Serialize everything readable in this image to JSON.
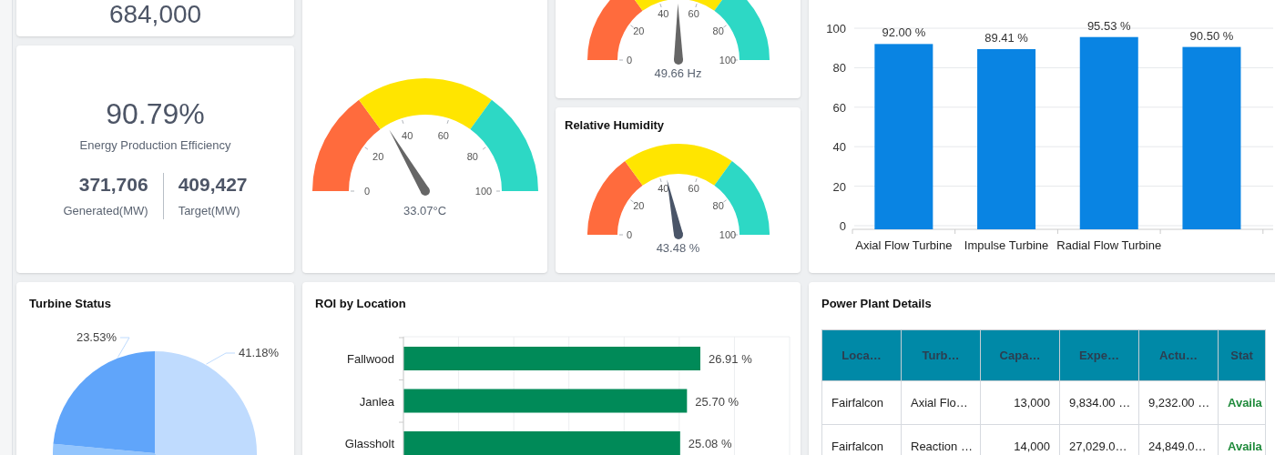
{
  "summary_card": {
    "value": "684,000"
  },
  "efficiency_card": {
    "value": "90.79%",
    "label": "Energy Production Efficiency",
    "generated": {
      "value": "371,706",
      "label": "Generated(MW)"
    },
    "target": {
      "value": "409,427",
      "label": "Target(MW)"
    }
  },
  "temperature_gauge": {
    "level": 0.3307,
    "reading": "33.07°C",
    "ticks": [
      "0",
      "20",
      "40",
      "60",
      "80",
      "100"
    ]
  },
  "frequency_gauge": {
    "level": 0.4966,
    "reading": "49.66 Hz",
    "ticks": [
      "0",
      "20",
      "40",
      "60",
      "80",
      "100"
    ]
  },
  "humidity_gauge": {
    "title": "Relative Humidity",
    "level": 0.4348,
    "reading": "43.48 %",
    "ticks": [
      "0",
      "20",
      "40",
      "60",
      "80",
      "100"
    ]
  },
  "turbine_efficiency_chart": {
    "chart_data": {
      "type": "bar",
      "categories": [
        "Axial Flow Turbine",
        "Impulse Turbine",
        "Radial Flow Turbine",
        null
      ],
      "values": [
        92.0,
        89.41,
        95.53,
        90.5
      ],
      "ylim": [
        0,
        100
      ],
      "grid": true,
      "yticks": [
        0,
        20,
        40,
        60,
        80,
        100
      ],
      "value_labels": [
        "92.00 %",
        "89.41 %",
        "95.53 %",
        "90.50 %"
      ]
    }
  },
  "turbine_status": {
    "title": "Turbine Status",
    "chart_data": {
      "type": "pie",
      "values": [
        41.18,
        35.29,
        23.53
      ],
      "value_labels": [
        "41.18%",
        null,
        "23.53%"
      ]
    }
  },
  "roi_by_location": {
    "title": "ROI by Location",
    "chart_data": {
      "type": "bar",
      "orientation": "horizontal",
      "grid": true,
      "categories": [
        "Fallwood",
        "Janlea",
        "Glassholt"
      ],
      "values": [
        26.91,
        25.7,
        25.08
      ],
      "xlim": [
        0,
        35
      ],
      "value_labels": [
        "26.91 %",
        "25.70 %",
        "25.08 %"
      ]
    }
  },
  "power_plant_details": {
    "title": "Power Plant Details",
    "columns": [
      "Loca…",
      "Turb…",
      "Capa…",
      "Expe…",
      "Actu…",
      "Stat"
    ],
    "rows": [
      [
        "Fairfalcon",
        "Axial Flo…",
        "13,000",
        "9,834.00 …",
        "9,232.00 …",
        "Availa"
      ],
      [
        "Fairfalcon",
        "Reaction …",
        "14,000",
        "27,029.0…",
        "24,849.0…",
        "Availa"
      ]
    ]
  }
}
